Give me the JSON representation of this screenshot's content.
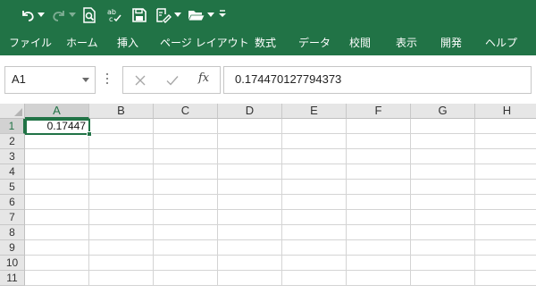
{
  "quick_access": {
    "icons": [
      "undo-icon",
      "redo-icon",
      "print-preview-icon",
      "spelling-icon",
      "save-icon",
      "touch-mode-icon",
      "open-folder-icon",
      "customize-qat-icon"
    ]
  },
  "menu": {
    "items": [
      "ファイル",
      "ホーム",
      "挿入",
      "ページ レイアウト",
      "数式",
      "データ",
      "校閲",
      "表示",
      "開発",
      "ヘルプ"
    ]
  },
  "name_box": {
    "value": "A1"
  },
  "formula_bar": {
    "fx_label": "fx",
    "value": "0.174470127794373"
  },
  "grid": {
    "columns": [
      "A",
      "B",
      "C",
      "D",
      "E",
      "F",
      "G",
      "H"
    ],
    "rows": [
      "1",
      "2",
      "3",
      "4",
      "5",
      "6",
      "7",
      "8",
      "9",
      "10",
      "11"
    ],
    "cells": {
      "A1": "0.17447"
    },
    "selected_cell": "A1"
  },
  "colors": {
    "ribbon": "#217346",
    "selection": "#217346"
  }
}
